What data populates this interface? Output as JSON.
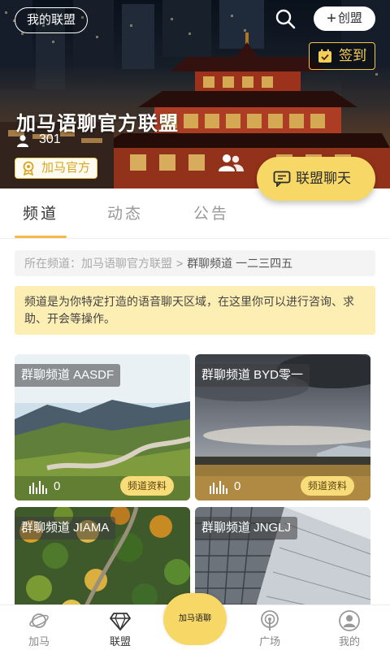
{
  "header": {
    "my_alliance": "我的联盟",
    "create_label": "创盟",
    "sign_in": "签到",
    "alliance_name": "加马语聊官方联盟",
    "member_count": "301",
    "official_badge": "加马官方",
    "chat_button": "联盟聊天"
  },
  "tabs": [
    {
      "label": "频道",
      "active": true
    },
    {
      "label": "动态",
      "active": false
    },
    {
      "label": "公告",
      "active": false
    }
  ],
  "breadcrumb": {
    "prefix": "所在频道：加马语聊官方联盟",
    "separator": ">",
    "current": "群聊频道 一二三四五"
  },
  "notice": "频道是为你特定打造的语音聊天区域，在这里你可以进行咨询、求助、开会等操作。",
  "channels": [
    {
      "name": "群聊频道 AASDF",
      "count": "0",
      "info_button": "频道资料"
    },
    {
      "name": "群聊频道 BYD零一",
      "count": "0",
      "info_button": "频道资料"
    },
    {
      "name": "群聊频道 JIAMA",
      "count": "",
      "info_button": ""
    },
    {
      "name": "群聊频道 JNGLJ",
      "count": "",
      "info_button": ""
    }
  ],
  "bottom_nav": [
    {
      "label": "加马",
      "icon": "planet-icon",
      "active": false
    },
    {
      "label": "联盟",
      "icon": "diamond-icon",
      "active": true
    },
    {
      "label": "加马语聊",
      "icon": "center-logo-icon",
      "active": false
    },
    {
      "label": "广场",
      "icon": "broadcast-icon",
      "active": false
    },
    {
      "label": "我的",
      "icon": "profile-icon",
      "active": false
    }
  ],
  "colors": {
    "accent_yellow": "#f7d766",
    "notice_bg": "#fdeeb4",
    "tab_underline": "#f4b94a",
    "official_gold": "#d9a520"
  }
}
